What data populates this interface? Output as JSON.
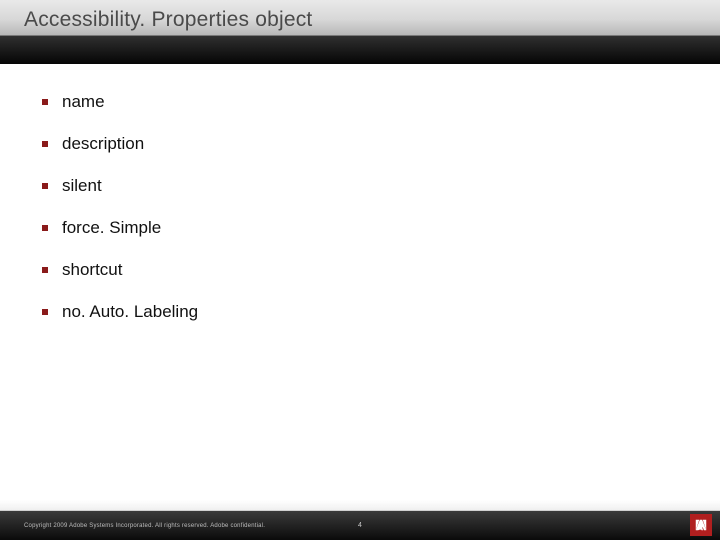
{
  "header": {
    "title": "Accessibility. Properties object"
  },
  "bullets": [
    {
      "label": "name"
    },
    {
      "label": "description"
    },
    {
      "label": "silent"
    },
    {
      "label": "force. Simple"
    },
    {
      "label": "shortcut"
    },
    {
      "label": "no. Auto. Labeling"
    }
  ],
  "footer": {
    "copyright": "Copyright 2009 Adobe Systems Incorporated.  All rights reserved.  Adobe confidential.",
    "page_number": "4"
  },
  "colors": {
    "bullet": "#8a1a1a",
    "logo_bg": "#b11f1f"
  }
}
